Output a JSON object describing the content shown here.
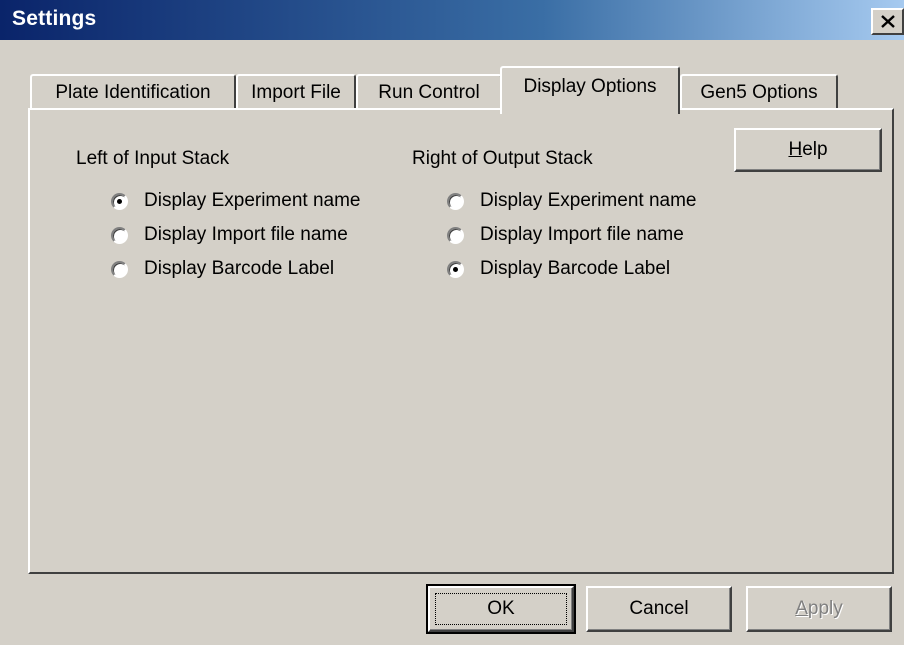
{
  "window": {
    "title": "Settings",
    "close_icon": "close-icon"
  },
  "tabs": [
    {
      "label": "Plate Identification",
      "active": false
    },
    {
      "label": "Import File",
      "active": false
    },
    {
      "label": "Run Control",
      "active": false
    },
    {
      "label": "Display Options",
      "active": true
    },
    {
      "label": "Gen5 Options",
      "active": false
    }
  ],
  "left_group": {
    "label": "Left of Input Stack",
    "options": [
      {
        "label": "Display Experiment name",
        "checked": true
      },
      {
        "label": "Display Import file name",
        "checked": false
      },
      {
        "label": "Display Barcode Label",
        "checked": false
      }
    ]
  },
  "right_group": {
    "label": "Right of Output Stack",
    "options": [
      {
        "label": "Display Experiment name",
        "checked": false
      },
      {
        "label": "Display Import file name",
        "checked": false
      },
      {
        "label": "Display Barcode Label",
        "checked": true
      }
    ]
  },
  "buttons": {
    "help": {
      "mnemonic": "H",
      "rest": "elp"
    },
    "ok": "OK",
    "cancel": "Cancel",
    "apply": {
      "mnemonic": "A",
      "rest": "pply",
      "disabled": true
    }
  }
}
